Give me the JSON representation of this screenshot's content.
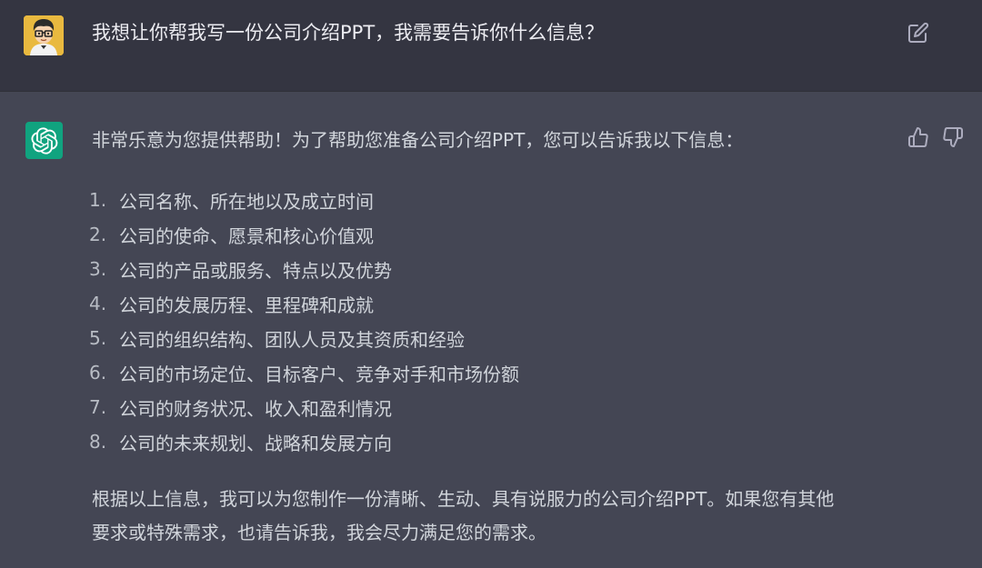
{
  "user": {
    "message": "我想让你帮我写一份公司介绍PPT，我需要告诉你什么信息？",
    "avatar_icon": "cartoon-user-avatar",
    "edit_icon": "edit-icon"
  },
  "assistant": {
    "avatar_icon": "openai-logo",
    "intro": "非常乐意为您提供帮助！为了帮助您准备公司介绍PPT，您可以告诉我以下信息：",
    "items": [
      {
        "num": "1.",
        "text": "公司名称、所在地以及成立时间"
      },
      {
        "num": "2.",
        "text": "公司的使命、愿景和核心价值观"
      },
      {
        "num": "3.",
        "text": "公司的产品或服务、特点以及优势"
      },
      {
        "num": "4.",
        "text": "公司的发展历程、里程碑和成就"
      },
      {
        "num": "5.",
        "text": "公司的组织结构、团队人员及其资质和经验"
      },
      {
        "num": "6.",
        "text": "公司的市场定位、目标客户、竞争对手和市场份额"
      },
      {
        "num": "7.",
        "text": "公司的财务状况、收入和盈利情况"
      },
      {
        "num": "8.",
        "text": "公司的未来规划、战略和发展方向"
      }
    ],
    "closing_line1": "根据以上信息，我可以为您制作一份清晰、生动、具有说服力的公司介绍PPT。如果您有其他",
    "closing_line2": "要求或特殊需求，也请告诉我，我会尽力满足您的需求。"
  },
  "colors": {
    "user_bg": "#343541",
    "assistant_bg": "#444654",
    "brand_green": "#10a37f",
    "text": "#d1d5db"
  }
}
